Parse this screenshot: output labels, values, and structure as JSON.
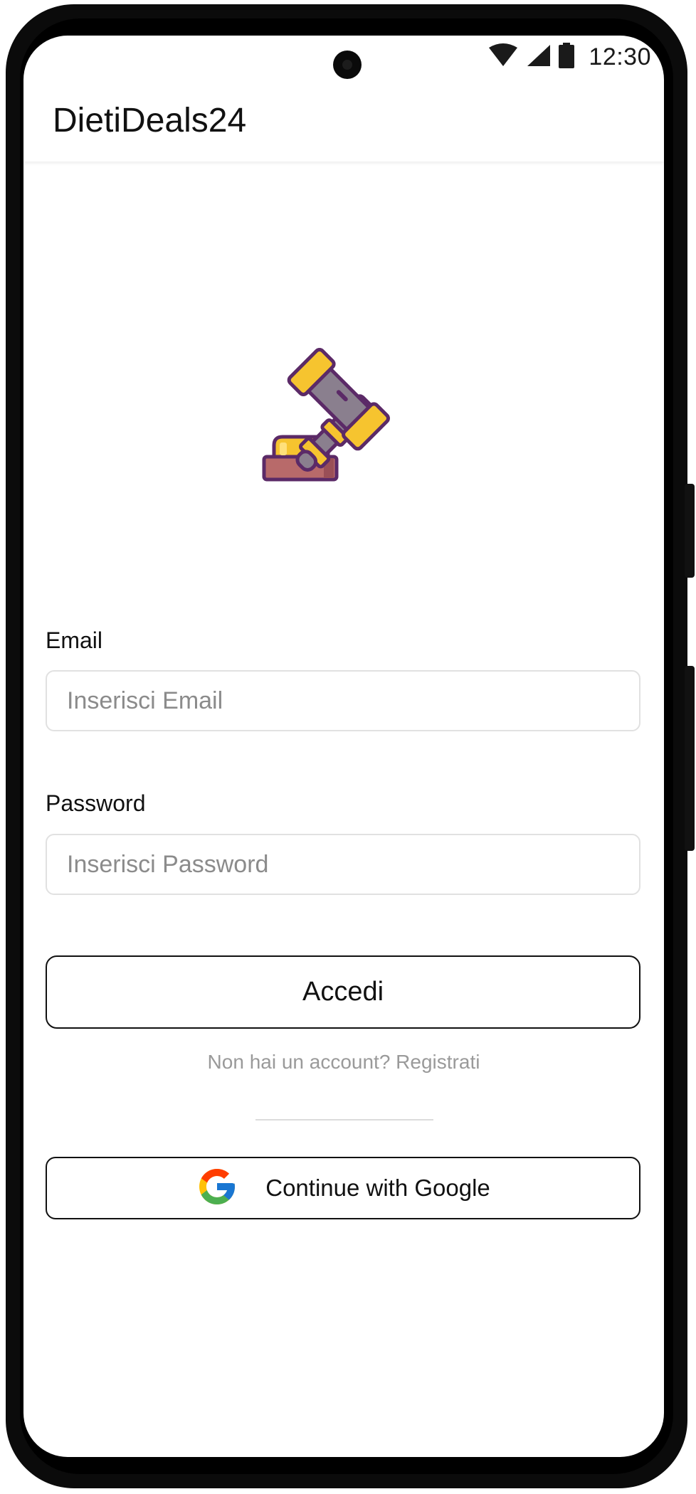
{
  "status_bar": {
    "time": "12:30",
    "icons": [
      "wifi-icon",
      "cellular-signal-icon",
      "battery-icon"
    ]
  },
  "app_bar": {
    "title": "DietiDeals24"
  },
  "logo": {
    "icon": "auction-gavel-icon"
  },
  "form": {
    "email": {
      "label": "Email",
      "placeholder": "Inserisci Email",
      "value": ""
    },
    "password": {
      "label": "Password",
      "placeholder": "Inserisci Password",
      "value": ""
    },
    "login_label": "Accedi",
    "register_prompt": "Non hai un account? Registrati",
    "google_label": "Continue with Google"
  },
  "colors": {
    "text_primary": "#111111",
    "muted": "#9a9a9a",
    "input_border": "#e1e1e1",
    "gavel_yellow": "#f6c42f",
    "gavel_grey": "#8a7f8e",
    "gavel_outline": "#5b2a67",
    "base_red": "#b86a6a"
  }
}
